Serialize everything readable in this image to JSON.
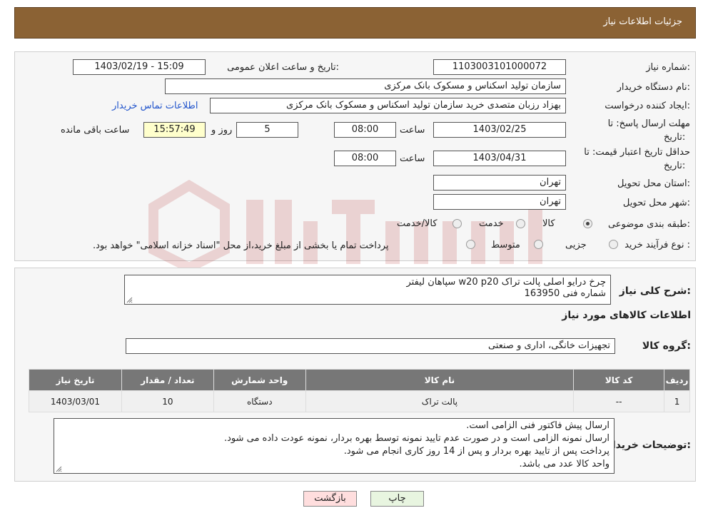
{
  "header": {
    "title": "جزئیات اطلاعات نیاز"
  },
  "form": {
    "need_number_label": "شماره نیاز:",
    "need_number": "1103003101000072",
    "announce_label": "تاریخ و ساعت اعلان عمومی:",
    "announce_value": "1403/02/19 - 15:09",
    "buyer_org_label": "نام دستگاه خریدار:",
    "buyer_org": "سازمان تولید اسکناس و مسکوک بانک مرکزی",
    "creator_label": "ایجاد کننده درخواست:",
    "creator": "بهزاد رزبان متصدی خرید سازمان تولید اسکناس و مسکوک بانک مرکزی",
    "contact_link": "اطلاعات تماس خریدار",
    "reply_deadline_label_1": "مهلت ارسال پاسخ: تا",
    "reply_deadline_label_2": "تاریخ:",
    "reply_date": "1403/02/25",
    "time_label": "ساعت",
    "reply_time": "08:00",
    "days_value": "5",
    "days_label": "روز و",
    "remaining_time": "15:57:49",
    "remaining_label": "ساعت باقی مانده",
    "price_validity_label_1": "حداقل تاریخ اعتبار قیمت: تا",
    "price_validity_label_2": "تاریخ:",
    "price_date": "1403/04/31",
    "price_time": "08:00",
    "province_label": "استان محل تحویل:",
    "province": "تهران",
    "city_label": "شهر محل تحویل:",
    "city": "تهران",
    "category_label": "طبقه بندی موضوعی:",
    "category_options": [
      "کالا",
      "خدمت",
      "کالا/خدمت"
    ],
    "category_selected": 0,
    "process_label": "نوع فرآیند خرید :",
    "process_options": [
      "جزیی",
      "متوسط"
    ],
    "process_note": "پرداخت تمام یا بخشی از مبلغ خرید،از محل \"اسناد خزانه اسلامی\" خواهد بود."
  },
  "summary": {
    "label": "شرح کلی نیاز:",
    "line1": "چرخ درایو اصلی پالت تراک w20 p20 سپاهان لیفتر",
    "line2": "شماره فنی 163950",
    "goods_info_title": "اطلاعات کالاهای مورد نیاز",
    "group_label": "گروه کالا:",
    "group_value": "تجهیزات خانگی، اداری و صنعتی"
  },
  "table": {
    "headers": [
      "ردیف",
      "کد کالا",
      "نام کالا",
      "واحد شمارش",
      "تعداد / مقدار",
      "تاریخ نیاز"
    ],
    "rows": [
      [
        "1",
        "--",
        "پالت تراک",
        "دستگاه",
        "10",
        "1403/03/01"
      ]
    ]
  },
  "buyer_notes": {
    "label": "توضیحات خریدار:",
    "lines": [
      "ارسال پیش فاکتور فنی الزامی است.",
      "ارسال نمونه الزامی است و در صورت عدم تایید نمونه توسط بهره بردار، نمونه عودت داده می شود.",
      "پرداخت پس از تایید بهره بردار و پس از 14 روز کاری انجام می شود.",
      "واحد کالا عدد می باشد."
    ]
  },
  "buttons": {
    "back": "بازگشت",
    "print": "چاپ"
  },
  "colors": {
    "header_bg": "#8b6234",
    "link": "#2255cc",
    "back_btn_bg": "#ffdede",
    "print_btn_bg": "#e8f5e0"
  }
}
